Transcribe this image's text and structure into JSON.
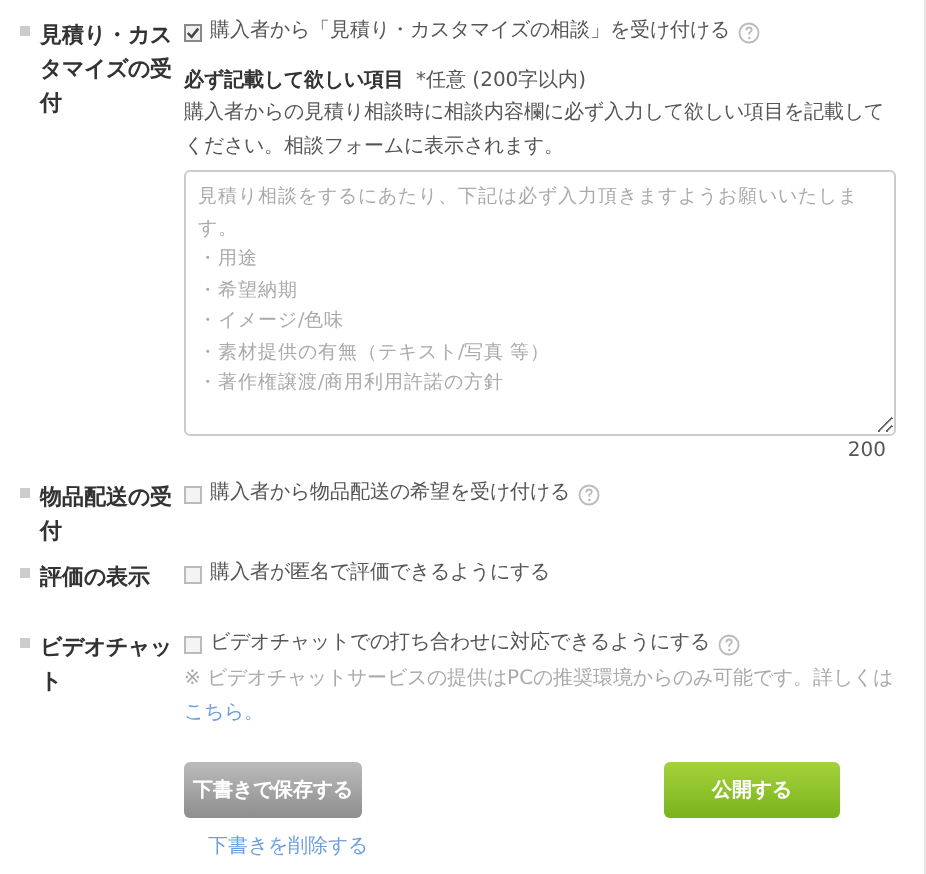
{
  "sections": [
    {
      "label": "見積り・カスタマイズの受付",
      "option": {
        "text": "購入者から「見積り・カスタマイズの相談」を受け付ける",
        "checked": true,
        "help": true
      },
      "required_items": {
        "title": "必ず記載して欲しい項目",
        "note": "*任意 (200字以内)",
        "description": "購入者からの見積り相談時に相談内容欄に必ず入力して欲しい項目を記載してください。相談フォームに表示されます。",
        "placeholder_lines": [
          "見積り相談をするにあたり、下記は必ず入力頂きますようお願いいたします。",
          "・用途",
          "・希望納期",
          "・イメージ/色味",
          "・素材提供の有無（テキスト/写真 等）",
          "・著作権譲渡/商用利用許諾の方針"
        ],
        "counter": "200"
      }
    },
    {
      "label": "物品配送の受付",
      "option": {
        "text": "購入者から物品配送の希望を受け付ける",
        "checked": false,
        "help": true
      }
    },
    {
      "label": "評価の表示",
      "option": {
        "text": "購入者が匿名で評価できるようにする",
        "checked": false,
        "help": false
      }
    },
    {
      "label": "ビデオチャット",
      "option": {
        "text": "ビデオチャットでの打ち合わせに対応できるようにする",
        "checked": false,
        "help": true
      },
      "note": {
        "text": "※ ビデオチャットサービスの提供はPCの推奨環境からのみ可能です。詳しくは",
        "link": "こちら。"
      }
    }
  ],
  "buttons": {
    "save_draft": "下書きで保存する",
    "publish": "公開する",
    "delete_draft": "下書きを削除する"
  }
}
